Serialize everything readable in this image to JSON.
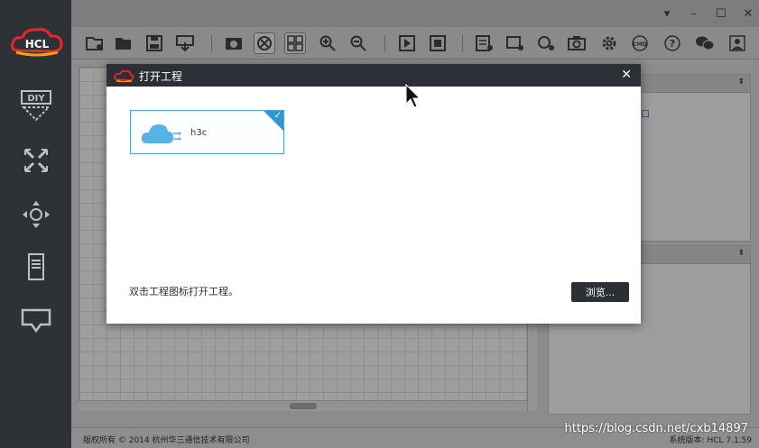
{
  "app": {
    "logo_text": "HCL"
  },
  "window_controls": {
    "menu": "▾",
    "minimize": "–",
    "maximize": "☐",
    "close": "✕"
  },
  "toolbar": {
    "items": [
      "new-project",
      "open-project",
      "save",
      "export",
      "screenshot",
      "start-all",
      "grid",
      "zoom-in",
      "zoom-out",
      "play",
      "stop",
      "log",
      "add-device",
      "add-link",
      "camera",
      "settings",
      "cmd",
      "help",
      "chat",
      "user"
    ]
  },
  "sidebar": {
    "items": [
      {
        "name": "diy",
        "label": "DIY"
      },
      {
        "name": "router",
        "label": ""
      },
      {
        "name": "switch",
        "label": ""
      },
      {
        "name": "server",
        "label": ""
      },
      {
        "name": "terminal",
        "label": ""
      }
    ]
  },
  "right_panel": {
    "link_fragment": "口"
  },
  "dialog": {
    "title": "打开工程",
    "close": "✕",
    "project": {
      "name": "h3c",
      "selected": true
    },
    "hint": "双击工程图标打开工程。",
    "browse_label": "浏览..."
  },
  "statusbar": {
    "copyright": "版权所有 © 2014 杭州华三通信技术有限公司",
    "version": "系统版本: HCL 7.1.59"
  },
  "watermark": "https://blog.csdn.net/cxb14897",
  "colors": {
    "sidebar_bg": "#2e3136",
    "dialog_title_bg": "#2c3036",
    "accent_blue": "#2f96d6",
    "cloud_blue": "#55b3e6"
  }
}
